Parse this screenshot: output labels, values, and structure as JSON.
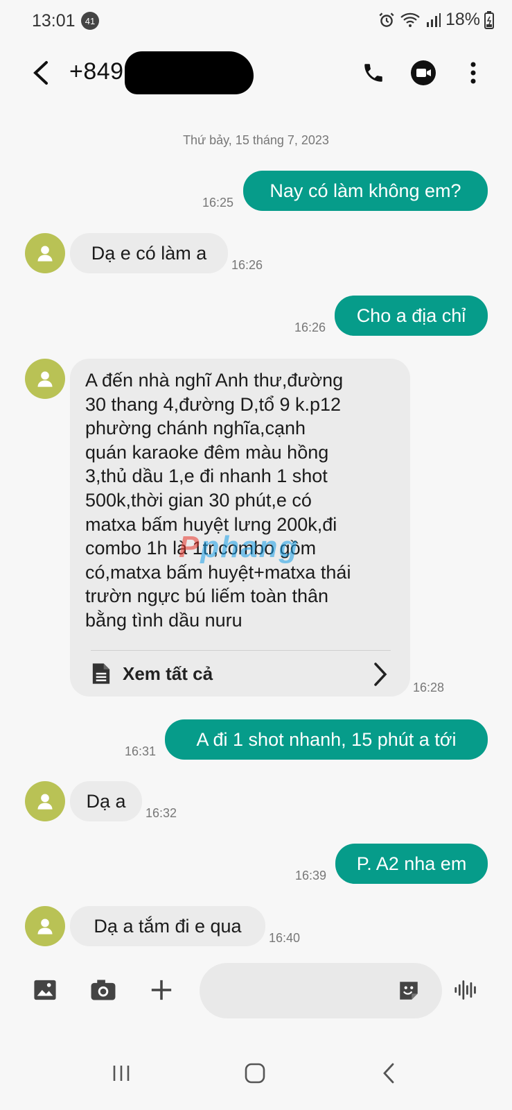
{
  "status_bar": {
    "time": "13:01",
    "notification_count": "41",
    "battery": "18%"
  },
  "header": {
    "contact": "+849",
    "icons": [
      "back-arrow-icon",
      "phone-icon",
      "video-call-icon",
      "more-vert-icon"
    ]
  },
  "conversation": {
    "date": "Thứ bảy, 15 tháng 7, 2023",
    "messages": [
      {
        "dir": "out",
        "text": "Nay có làm không em?",
        "time": "16:25"
      },
      {
        "dir": "in",
        "text": "Dạ e có làm a",
        "time": "16:26"
      },
      {
        "dir": "out",
        "text": "Cho a địa chỉ",
        "time": "16:26"
      },
      {
        "dir": "in",
        "text": "A đến nhà nghĩ Anh thư,đường\n30 thang 4,đường D,tổ 9 k.p12\nphường chánh nghĩa,cạnh\nquán karaoke đêm màu hồng\n3,thủ dầu 1,e đi nhanh 1 shot\n500k,thời gian 30 phút,e có\nmatxa bấm huyệt lưng 200k,đi\ncombo 1h là 1tr,combo gồm\ncó,matxa bấm huyệt+matxa thái\ntrườn ngực bú liếm toàn thân\nbằng tình dầu nuru",
        "time": "16:28",
        "see_all": "Xem tất cả"
      },
      {
        "dir": "out",
        "text": "A đi 1 shot nhanh, 15 phút a tới",
        "time": "16:31"
      },
      {
        "dir": "in",
        "text": "Dạ a",
        "time": "16:32"
      },
      {
        "dir": "out",
        "text": "P. A2 nha em",
        "time": "16:39"
      },
      {
        "dir": "in",
        "text": "Dạ a tắm đi e qua",
        "time": "16:40"
      }
    ]
  },
  "watermark": {
    "first": "P",
    "rest": "phang"
  },
  "composer": {
    "placeholder": "",
    "icons": [
      "gallery-icon",
      "camera-icon",
      "add-icon",
      "sticker-icon",
      "voice-icon"
    ]
  },
  "navbar": {
    "icons": [
      "recents-icon",
      "home-icon",
      "back-icon"
    ]
  },
  "colors": {
    "outgoing": "#069c8a",
    "incoming": "#ebebeb",
    "avatar": "#b9c255",
    "background": "#f7f7f7"
  }
}
